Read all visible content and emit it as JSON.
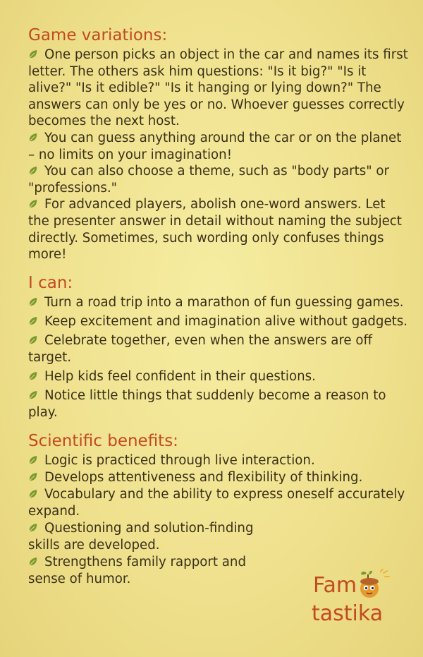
{
  "colors": {
    "heading": "#c24a21",
    "leaf": "#7a9a2e",
    "text": "#3a3018",
    "background": "#f1e491"
  },
  "sections": [
    {
      "heading": "Game variations:",
      "items": [
        "One person picks an object in the car and names its first letter. The others ask him questions: \"Is it big?\" \"Is it alive?\" \"Is it edible?\" \"Is it hanging or lying down?\" The answers can only be yes or no. Whoever guesses cor­rectly becomes the next host.",
        "You can guess anything around the car or on the planet – no limits on your imagination!",
        "You can also choose a theme, such as \"body parts\" or \"professions.\"",
        "For advanced players, abolish one-word answers. Let the presenter answer in detail without naming the subject directly. Sometimes, such wording only confuses things more!"
      ]
    },
    {
      "heading": "I can:",
      "items": [
        "Turn a road trip into a marathon of fun guessing games.",
        "Keep excitement and imagination alive without gadgets.",
        "Celebrate together, even when the answers are off target.",
        "Help kids feel confident in their questions.",
        "Notice little things that suddenly become a reason to play."
      ]
    },
    {
      "heading": "Scientific benefits:",
      "items": [
        "Logic is practiced through live interaction.",
        "Develops attentiveness and flexibility of thinking.",
        "Vocabulary and the ability to express oneself accurately expand.",
        "Questioning and solution-finding skills are developed.",
        "Strengthens family rapport and sense of humor."
      ]
    }
  ],
  "logo": {
    "line1": "Fam",
    "line2": "tastika",
    "icon": "acorn-mascot-icon"
  },
  "bullet_icon": "leaf-icon"
}
